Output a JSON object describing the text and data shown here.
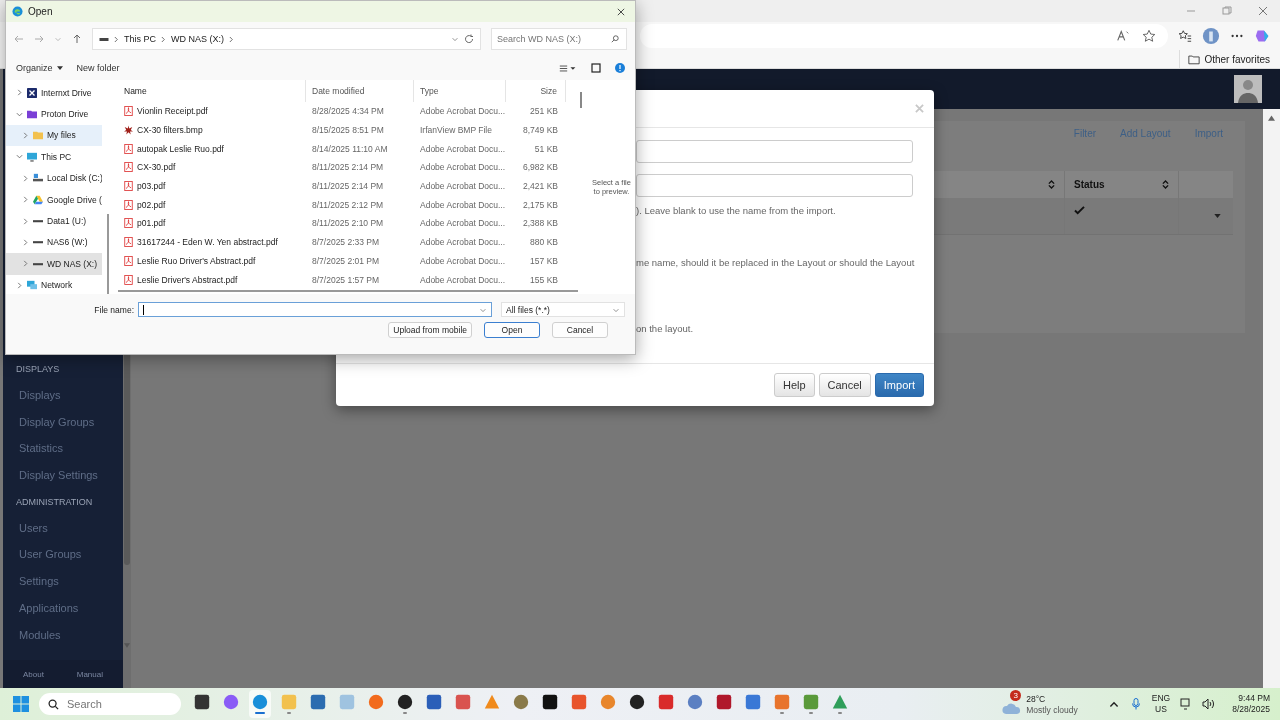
{
  "browser": {
    "other_favorites": "Other favorites"
  },
  "app": {
    "actions": [
      "Filter",
      "Add Layout",
      "Import"
    ],
    "table": {
      "columns": [
        "Status"
      ],
      "rows": [
        {
          "checked": true
        }
      ]
    },
    "sidebar": {
      "sections": [
        {
          "heading": "DISPLAYS",
          "items": [
            "Displays",
            "Display Groups",
            "Statistics",
            "Display Settings"
          ]
        },
        {
          "heading": "ADMINISTRATION",
          "items": [
            "Users",
            "User Groups",
            "Settings",
            "Applications",
            "Modules"
          ]
        }
      ],
      "footer": [
        "About",
        "Manual"
      ]
    }
  },
  "modal": {
    "texts": [
      "). Leave blank to use the name from the import.",
      "me name, should it be replaced in the Layout or should the Layout",
      "on the layout."
    ],
    "buttons": [
      {
        "label": "Help",
        "kind": "default"
      },
      {
        "label": "Cancel",
        "kind": "default"
      },
      {
        "label": "Import",
        "kind": "primary"
      }
    ]
  },
  "dialog": {
    "title": "Open",
    "breadcrumb": [
      "This PC",
      "WD NAS (X:)"
    ],
    "search_placeholder": "Search WD NAS (X:)",
    "organize": "Organize",
    "new_folder": "New folder",
    "nav_tree": [
      {
        "label": "Internxt Drive",
        "kind": "internxt",
        "expanded": false,
        "selected": false,
        "hovered": false
      },
      {
        "label": "Proton Drive",
        "kind": "proton",
        "expanded": true,
        "selected": false,
        "hovered": false,
        "children": [
          {
            "label": "My files",
            "kind": "folder",
            "expanded": false,
            "selected": false,
            "hovered": true
          }
        ]
      },
      {
        "label": "This PC",
        "kind": "pc",
        "expanded": true,
        "selected": false,
        "hovered": false,
        "children": [
          {
            "label": "Local Disk (C:)",
            "kind": "disk",
            "expanded": false,
            "selected": false,
            "hovered": false
          },
          {
            "label": "Google Drive (",
            "kind": "gdrive",
            "expanded": false,
            "selected": false,
            "hovered": false
          },
          {
            "label": "Data1 (U:)",
            "kind": "drive",
            "expanded": false,
            "selected": false,
            "hovered": false
          },
          {
            "label": "NAS6 (W:)",
            "kind": "drive",
            "expanded": false,
            "selected": false,
            "hovered": false
          },
          {
            "label": "WD NAS (X:)",
            "kind": "drive",
            "expanded": false,
            "selected": true,
            "hovered": false
          }
        ]
      },
      {
        "label": "Network",
        "kind": "network",
        "expanded": false,
        "selected": false,
        "hovered": false
      }
    ],
    "columns": [
      "Name",
      "Date modified",
      "Type",
      "Size"
    ],
    "files": [
      {
        "name": "Vionlin Receipt.pdf",
        "kind": "pdf",
        "date": "8/28/2025 4:34 PM",
        "type": "Adobe Acrobat Docu...",
        "size": "251 KB"
      },
      {
        "name": "CX-30 filters.bmp",
        "kind": "bmp",
        "date": "8/15/2025 8:51 PM",
        "type": "IrfanView BMP File",
        "size": "8,749 KB"
      },
      {
        "name": "autopak Leslie Ruo.pdf",
        "kind": "pdf",
        "date": "8/14/2025 11:10 AM",
        "type": "Adobe Acrobat Docu...",
        "size": "51 KB"
      },
      {
        "name": "CX-30.pdf",
        "kind": "pdf",
        "date": "8/11/2025 2:14 PM",
        "type": "Adobe Acrobat Docu...",
        "size": "6,982 KB"
      },
      {
        "name": "p03.pdf",
        "kind": "pdf",
        "date": "8/11/2025 2:14 PM",
        "type": "Adobe Acrobat Docu...",
        "size": "2,421 KB"
      },
      {
        "name": "p02.pdf",
        "kind": "pdf",
        "date": "8/11/2025 2:12 PM",
        "type": "Adobe Acrobat Docu...",
        "size": "2,175 KB"
      },
      {
        "name": "p01.pdf",
        "kind": "pdf",
        "date": "8/11/2025 2:10 PM",
        "type": "Adobe Acrobat Docu...",
        "size": "2,388 KB"
      },
      {
        "name": "31617244 - Eden W. Yen abstract.pdf",
        "kind": "pdf",
        "date": "8/7/2025 2:33 PM",
        "type": "Adobe Acrobat Docu...",
        "size": "880 KB"
      },
      {
        "name": "Leslie Ruo Driver's Abstract.pdf",
        "kind": "pdf",
        "date": "8/7/2025 2:01 PM",
        "type": "Adobe Acrobat Docu...",
        "size": "157 KB"
      },
      {
        "name": "Leslie Driver's Abstract.pdf",
        "kind": "pdf",
        "date": "8/7/2025 1:57 PM",
        "type": "Adobe Acrobat Docu...",
        "size": "155 KB"
      }
    ],
    "preview": "Select a file to preview.",
    "file_name_label": "File name:",
    "filter": "All files (*.*)",
    "buttons": [
      {
        "label": "Upload from mobile",
        "kind": "default"
      },
      {
        "label": "Open",
        "kind": "primary"
      },
      {
        "label": "Cancel",
        "kind": "default"
      }
    ]
  },
  "taskbar": {
    "search_placeholder": "Search",
    "apps": [
      {
        "kind": "taskview",
        "running": false,
        "active": false
      },
      {
        "kind": "copilot",
        "running": false,
        "active": false
      },
      {
        "kind": "edge",
        "running": true,
        "active": true
      },
      {
        "kind": "explorer",
        "running": true,
        "active": false
      },
      {
        "kind": "store",
        "running": false,
        "active": false
      },
      {
        "kind": "notepad",
        "running": false,
        "active": false
      },
      {
        "kind": "firefox",
        "running": false,
        "active": false
      },
      {
        "kind": "obs",
        "running": true,
        "active": false
      },
      {
        "kind": "word",
        "running": false,
        "active": false
      },
      {
        "kind": "snip",
        "running": false,
        "active": false
      },
      {
        "kind": "vlc",
        "running": false,
        "active": false
      },
      {
        "kind": "gimp",
        "running": false,
        "active": false
      },
      {
        "kind": "meter",
        "running": false,
        "active": false
      },
      {
        "kind": "brave",
        "running": false,
        "active": false
      },
      {
        "kind": "swirl",
        "running": false,
        "active": false
      },
      {
        "kind": "player",
        "running": false,
        "active": false
      },
      {
        "kind": "reader",
        "running": false,
        "active": false
      },
      {
        "kind": "atom",
        "running": false,
        "active": false
      },
      {
        "kind": "recorder",
        "running": false,
        "active": false
      },
      {
        "kind": "headphones",
        "running": false,
        "active": false
      },
      {
        "kind": "xampp",
        "running": true,
        "active": false
      },
      {
        "kind": "sheet",
        "running": true,
        "active": false
      },
      {
        "kind": "gdrive",
        "running": true,
        "active": false
      }
    ],
    "weather": {
      "badge": "3",
      "temperature": "28°C",
      "condition": "Mostly cloudy"
    },
    "language": "ENG",
    "region": "US",
    "time": "9:44 PM",
    "date": "8/28/2025"
  }
}
